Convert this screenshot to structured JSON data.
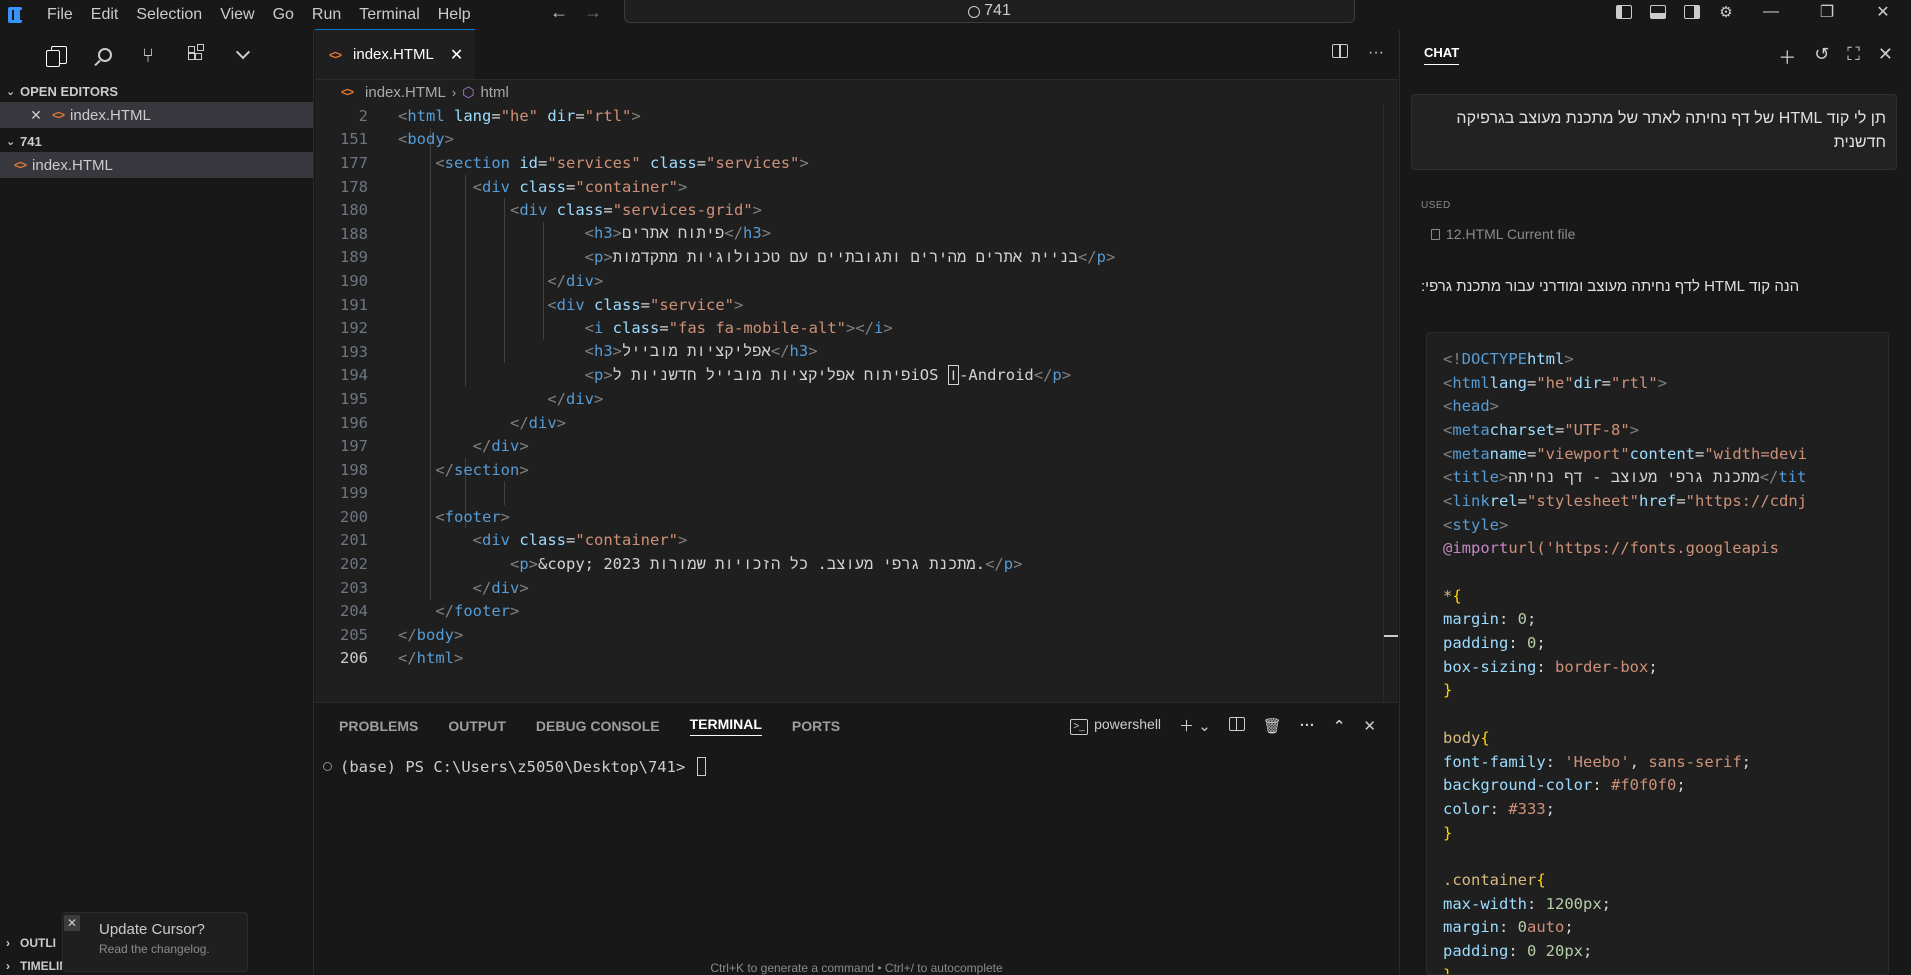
{
  "menu": [
    "File",
    "Edit",
    "Selection",
    "View",
    "Go",
    "Run",
    "Terminal",
    "Help"
  ],
  "command_center": "741",
  "sidebar": {
    "open_editors_label": "OPEN EDITORS",
    "open_editor_file": "index.HTML",
    "folder_label": "741",
    "folder_file": "index.HTML",
    "outline_label": "OUTLI",
    "timeline_label": "TIMELINE",
    "toast_title": "Update Cursor?",
    "toast_sub": "Read the changelog."
  },
  "editor": {
    "tab_label": "index.HTML",
    "breadcrumb_file": "index.HTML",
    "breadcrumb_symbol": "html",
    "line_numbers": [
      "2",
      "151",
      "177",
      "178",
      "180",
      "188",
      "189",
      "190",
      "191",
      "192",
      "193",
      "194",
      "195",
      "196",
      "197",
      "198",
      "199",
      "200",
      "201",
      "202",
      "203",
      "204",
      "205",
      "206"
    ],
    "current_line": "206",
    "rtl_text": {
      "h3_dev": "פיתוח אתרים",
      "p_dev": "בניית אתרים מהירים ותגובתיים עם טכנולוגיות מתקדמות",
      "h3_mobile": "אפליקציות מובייל",
      "p_mobile_a": "פיתוח אפליקציות מובייל חדשניות ל",
      "p_mobile_b": "iOS ",
      "p_mobile_c": "ו",
      "p_mobile_d": "-Android",
      "footer_p": "מתכנת גרפי מעוצב. כל הזכויות שמורות"
    }
  },
  "panel": {
    "tabs": [
      "PROBLEMS",
      "OUTPUT",
      "DEBUG CONSOLE",
      "TERMINAL",
      "PORTS"
    ],
    "active_tab": "TERMINAL",
    "shell": "powershell",
    "prompt": "(base) PS C:\\Users\\z5050\\Desktop\\741> ",
    "hint": "Ctrl+K to generate a command • Ctrl+/ to autocomplete"
  },
  "chat": {
    "title": "CHAT",
    "user_message": "תן לי קוד HTML של דף נחיתה לאתר של מתכנת מעוצב בגרפיקה חדשנית",
    "used_label": "USED",
    "used_file": "12.HTML Current file",
    "assistant_intro": "הנה קוד HTML לדף נחיתה מעוצב ומודרני עבור מתכנת גרפי:",
    "code": {
      "title_text": "מתכנת גרפי מעוצב - דף נחיתה",
      "viewport_partial": "\"width=devi",
      "link_partial": "\"https://cdnj",
      "import_partial": "url('https://fonts.googleapis"
    }
  },
  "colors": {
    "accent": "#0078d4",
    "tag_blue": "#569cd6",
    "attr": "#9cdcfe",
    "string": "#ce9178"
  }
}
